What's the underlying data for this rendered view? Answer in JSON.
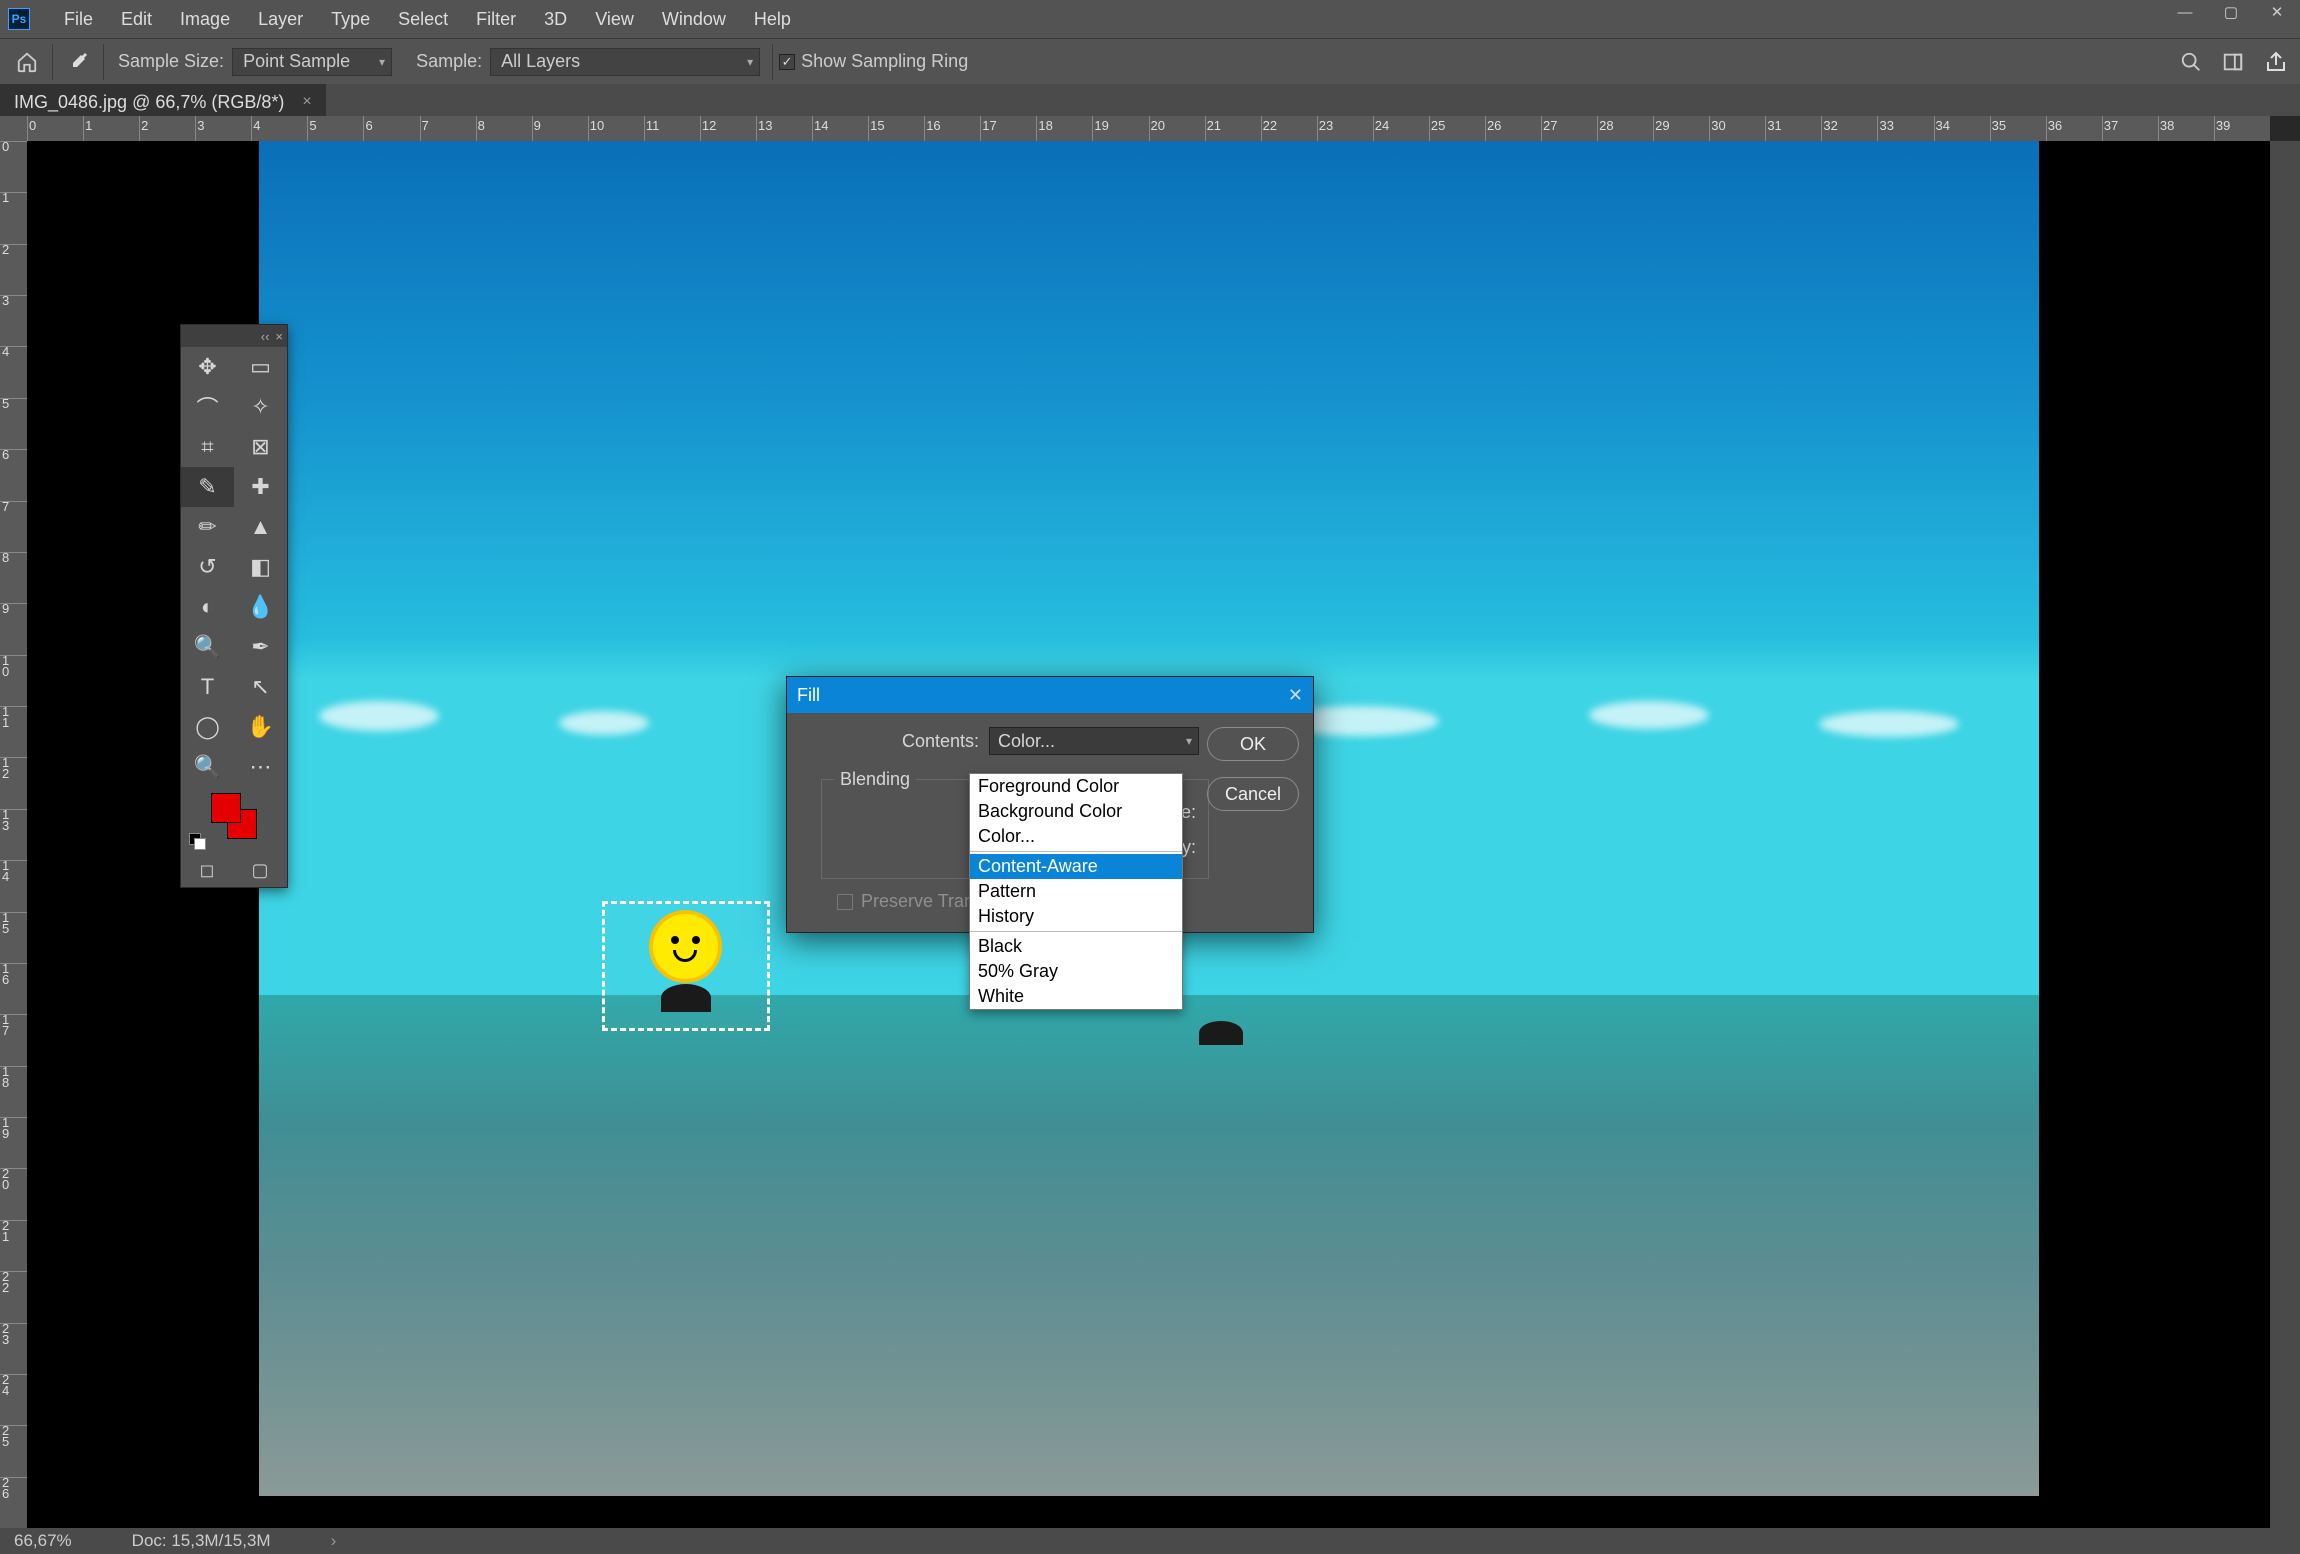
{
  "menu": {
    "items": [
      "File",
      "Edit",
      "Image",
      "Layer",
      "Type",
      "Select",
      "Filter",
      "3D",
      "View",
      "Window",
      "Help"
    ]
  },
  "options": {
    "sample_size_label": "Sample Size:",
    "sample_size_value": "Point Sample",
    "sample_label": "Sample:",
    "sample_value": "All Layers",
    "show_sampling_ring": "Show Sampling Ring"
  },
  "document": {
    "tab_title": "IMG_0486.jpg @ 66,7% (RGB/8*)"
  },
  "tools": [
    {
      "name": "move-tool",
      "glyph": "✥"
    },
    {
      "name": "marquee-tool",
      "glyph": "▭"
    },
    {
      "name": "lasso-tool",
      "glyph": "⌒"
    },
    {
      "name": "magic-wand-tool",
      "glyph": "✧"
    },
    {
      "name": "crop-tool",
      "glyph": "⌗"
    },
    {
      "name": "frame-tool",
      "glyph": "⊠"
    },
    {
      "name": "eyedropper-tool",
      "glyph": "✎",
      "active": true
    },
    {
      "name": "healing-tool",
      "glyph": "✚"
    },
    {
      "name": "brush-tool",
      "glyph": "✏"
    },
    {
      "name": "stamp-tool",
      "glyph": "▲"
    },
    {
      "name": "history-brush-tool",
      "glyph": "↺"
    },
    {
      "name": "eraser-tool",
      "glyph": "◧"
    },
    {
      "name": "gradient-tool",
      "glyph": "◐"
    },
    {
      "name": "blur-tool",
      "glyph": "💧"
    },
    {
      "name": "dodge-tool",
      "glyph": "🔍"
    },
    {
      "name": "pen-tool",
      "glyph": "✒"
    },
    {
      "name": "type-tool",
      "glyph": "T"
    },
    {
      "name": "path-select-tool",
      "glyph": "↖"
    },
    {
      "name": "shape-tool",
      "glyph": "◯"
    },
    {
      "name": "hand-tool",
      "glyph": "✋"
    },
    {
      "name": "zoom-tool",
      "glyph": "🔍"
    },
    {
      "name": "more-tool",
      "glyph": "⋯"
    }
  ],
  "swatch": {
    "fg": "#e40000",
    "bg": "#e40000"
  },
  "fill_dialog": {
    "title": "Fill",
    "contents_label": "Contents:",
    "contents_value": "Color...",
    "blending_legend": "Blending",
    "mode_label": "Mode:",
    "opacity_label": "Opacity:",
    "preserve_label": "Preserve Transparency",
    "ok": "OK",
    "cancel": "Cancel",
    "options": [
      "Foreground Color",
      "Background Color",
      "Color...",
      "Content-Aware",
      "Pattern",
      "History",
      "Black",
      "50% Gray",
      "White"
    ],
    "highlighted_option": "Content-Aware"
  },
  "status": {
    "zoom": "66,67%",
    "doc": "Doc: 15,3M/15,3M"
  },
  "ruler": {
    "h_labels": [
      "0",
      "1",
      "2",
      "3",
      "4",
      "5",
      "6",
      "7",
      "8",
      "9",
      "10",
      "11",
      "12",
      "13",
      "14",
      "15",
      "16",
      "17",
      "18",
      "19",
      "20",
      "21",
      "22",
      "23",
      "24",
      "25",
      "26",
      "27",
      "28",
      "29",
      "30",
      "31",
      "32",
      "33",
      "34",
      "35",
      "36",
      "37",
      "38",
      "39"
    ],
    "v_labels": [
      "0",
      "1",
      "2",
      "3",
      "4",
      "5",
      "6",
      "7",
      "8",
      "9",
      "10",
      "11",
      "12",
      "13",
      "14",
      "15",
      "16",
      "17",
      "18",
      "19",
      "20",
      "21",
      "22",
      "23",
      "24",
      "25",
      "26"
    ]
  }
}
